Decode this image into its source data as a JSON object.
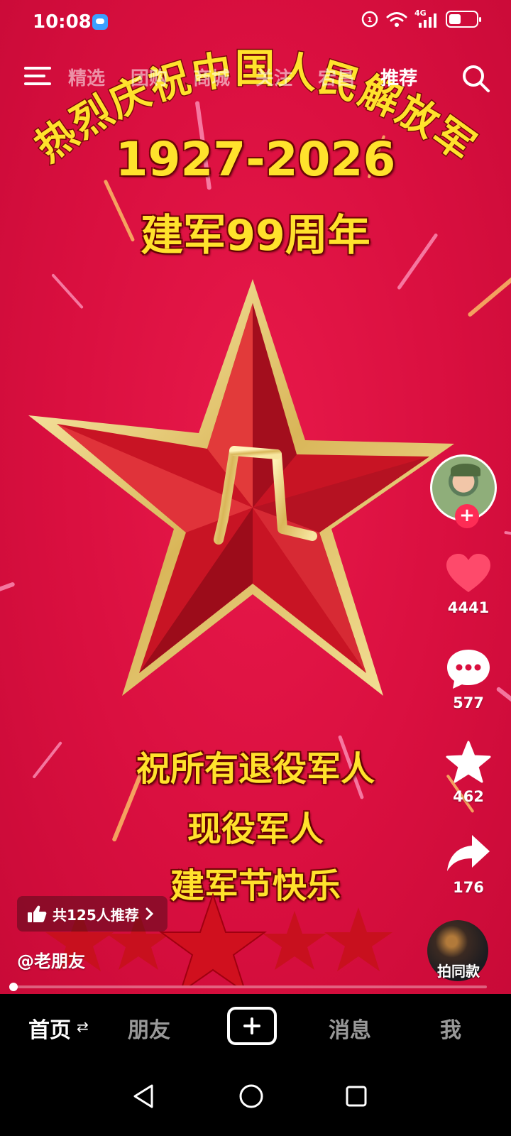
{
  "status_bar": {
    "time": "10:08",
    "network": "4G"
  },
  "top_nav": {
    "tabs": [
      {
        "label": "精选",
        "active": false
      },
      {
        "label": "团购",
        "active": false
      },
      {
        "label": "商城",
        "active": false
      },
      {
        "label": "关注",
        "active": false
      },
      {
        "label": "宕昌",
        "active": false
      },
      {
        "label": "推荐",
        "active": true
      }
    ]
  },
  "video": {
    "arc_title": "热烈庆祝中国人民解放军",
    "years": "1927-2026",
    "anniversary": "建军99周年",
    "wishes": [
      "祝所有退役军人",
      "现役军人",
      "建军节快乐"
    ],
    "emblem_text": "八一",
    "colors": {
      "background": "#d90f3f",
      "headline": "#ffe22c",
      "star": "#c81424",
      "star_border": "#e8d27a"
    }
  },
  "side_rail": {
    "likes": "4441",
    "comments": "577",
    "favorites": "462",
    "shares": "176"
  },
  "overlay": {
    "recommend_text": "共125人推荐",
    "author": "@老朋友",
    "same_style_label": "拍同款",
    "progress_fraction": 0.01
  },
  "bottom_nav": {
    "home": "首页",
    "friends": "朋友",
    "messages": "消息",
    "me": "我"
  }
}
